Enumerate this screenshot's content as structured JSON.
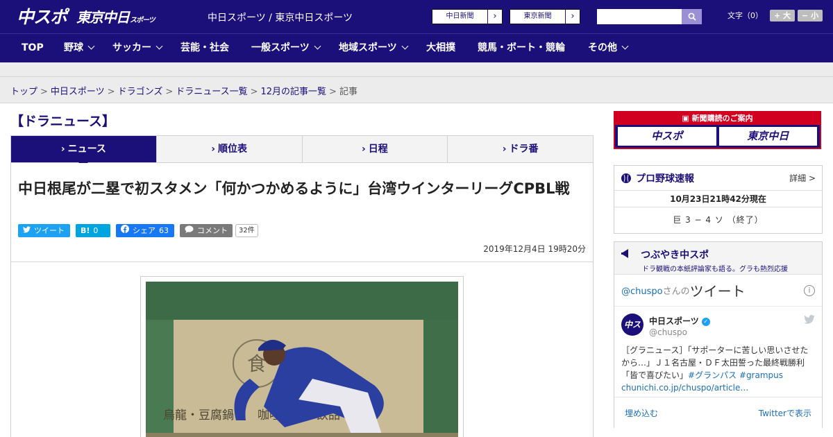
{
  "header": {
    "logo_main": "中スポ",
    "logo_tokyo": "東京中日",
    "logo_tokyo_small": "スポーツ",
    "site_name": "中日スポーツ / 東京中日スポーツ",
    "paper_buttons": [
      "中日新聞",
      "東京新聞"
    ],
    "fontsize_label": "文字（0）",
    "fontsize_plus": "+ 大",
    "fontsize_minus": "− 小"
  },
  "nav": {
    "items": [
      {
        "label": "TOP"
      },
      {
        "label": "野球"
      },
      {
        "label": "サッカー"
      },
      {
        "label": "芸能・社会"
      },
      {
        "label": "一般スポーツ"
      },
      {
        "label": "地域スポーツ"
      },
      {
        "label": "大相撲"
      },
      {
        "label": "競馬・ボート・競輪"
      },
      {
        "label": "その他"
      }
    ]
  },
  "breadcrumb": {
    "items": [
      "トップ",
      "中日スポーツ",
      "ドラゴンズ",
      "ドラニュース一覧",
      "12月の記事一覧"
    ],
    "current": "記事",
    "separator": ">"
  },
  "section_title": "【ドラニュース】",
  "tabs": [
    "ニュース",
    "順位表",
    "日程",
    "ドラ番"
  ],
  "article": {
    "headline": "中日根尾が二塁で初スタメン「何かつかめるように」台湾ウインターリーグCPBL戦",
    "share": {
      "tweet": "ツイート",
      "hatena_icon": "B!",
      "hatena_count": "0",
      "facebook": "シェア",
      "facebook_count": "63",
      "comment": "コメント",
      "comment_count": "32件"
    },
    "date": "2019年12月4日 19時20分"
  },
  "sidebar": {
    "ad_head": "新聞購読のご案内",
    "ad_logos": [
      "中スポ",
      "東京中日"
    ],
    "score": {
      "title": "プロ野球速報",
      "detail": "詳細 >",
      "time": "10月23日21時42分現在",
      "line": "巨 3 − 4 ソ （終了）"
    },
    "tweets": {
      "title": "つぶやき中スポ",
      "subtitle": "ドラ観戦の本紙評論家も語る。グラも熱烈応援",
      "handle": "@chuspo",
      "handle_suffix": "さんの",
      "big": "ツイート",
      "name": "中日スポーツ",
      "user": "@chuspo",
      "text": "［グラニュース］「サポーターに苦しい思いさせたから…」Ｊ１名古屋・ＤＦ太田誓った最終戦勝利「皆で喜びたい」",
      "tags": "#グランパス #grampus",
      "link": "chunichi.co.jp/chuspo/article…",
      "embed": "埋め込む",
      "view": "Twitterで表示",
      "avatar": "中スポ"
    }
  },
  "colors": {
    "brand": "#1b0f7a",
    "accent_red": "#d10020",
    "twitter": "#1da1f2",
    "hatena": "#00a4de",
    "facebook": "#1877f2"
  }
}
